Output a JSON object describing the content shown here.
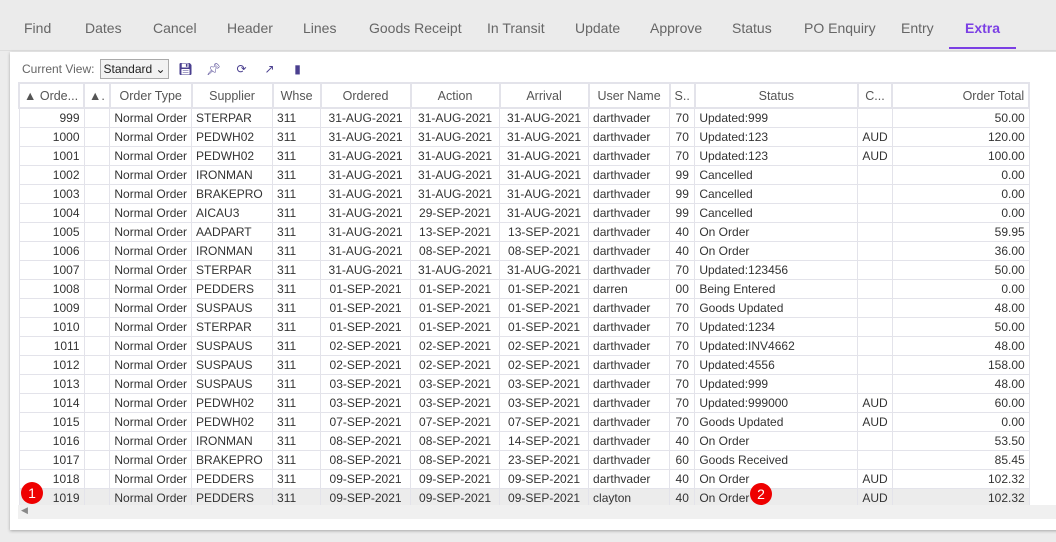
{
  "tabs": [
    "Find",
    "Dates",
    "Cancel",
    "Header",
    "Lines",
    "Goods Receipt",
    "In Transit",
    "Update",
    "Approve",
    "Status",
    "PO Enquiry",
    "Entry",
    "Extra"
  ],
  "active_tab": "Extra",
  "toolbar": {
    "view_label": "Current View:",
    "view_value": "Standard"
  },
  "columns": [
    "▲ Orde...",
    "▲.",
    "Order Type",
    "Supplier",
    "Whse",
    "Ordered",
    "Action",
    "Arrival",
    "User Name",
    "S..",
    "Status",
    "C...",
    "Order Total"
  ],
  "rows": [
    [
      "999",
      "",
      "Normal Order",
      "STERPAR",
      "311",
      "31-AUG-2021",
      "31-AUG-2021",
      "31-AUG-2021",
      "darthvader",
      "70",
      "Updated:999",
      "",
      "50.00"
    ],
    [
      "1000",
      "",
      "Normal Order",
      "PEDWH02",
      "311",
      "31-AUG-2021",
      "31-AUG-2021",
      "31-AUG-2021",
      "darthvader",
      "70",
      "Updated:123",
      "AUD",
      "120.00"
    ],
    [
      "1001",
      "",
      "Normal Order",
      "PEDWH02",
      "311",
      "31-AUG-2021",
      "31-AUG-2021",
      "31-AUG-2021",
      "darthvader",
      "70",
      "Updated:123",
      "AUD",
      "100.00"
    ],
    [
      "1002",
      "",
      "Normal Order",
      "IRONMAN",
      "311",
      "31-AUG-2021",
      "31-AUG-2021",
      "31-AUG-2021",
      "darthvader",
      "99",
      "Cancelled",
      "",
      "0.00"
    ],
    [
      "1003",
      "",
      "Normal Order",
      "BRAKEPRO",
      "311",
      "31-AUG-2021",
      "31-AUG-2021",
      "31-AUG-2021",
      "darthvader",
      "99",
      "Cancelled",
      "",
      "0.00"
    ],
    [
      "1004",
      "",
      "Normal Order",
      "AICAU3",
      "311",
      "31-AUG-2021",
      "29-SEP-2021",
      "31-AUG-2021",
      "darthvader",
      "99",
      "Cancelled",
      "",
      "0.00"
    ],
    [
      "1005",
      "",
      "Normal Order",
      "AADPART",
      "311",
      "31-AUG-2021",
      "13-SEP-2021",
      "13-SEP-2021",
      "darthvader",
      "40",
      "On Order",
      "",
      "59.95"
    ],
    [
      "1006",
      "",
      "Normal Order",
      "IRONMAN",
      "311",
      "31-AUG-2021",
      "08-SEP-2021",
      "08-SEP-2021",
      "darthvader",
      "40",
      "On Order",
      "",
      "36.00"
    ],
    [
      "1007",
      "",
      "Normal Order",
      "STERPAR",
      "311",
      "31-AUG-2021",
      "31-AUG-2021",
      "31-AUG-2021",
      "darthvader",
      "70",
      "Updated:123456",
      "",
      "50.00"
    ],
    [
      "1008",
      "",
      "Normal Order",
      "PEDDERS",
      "311",
      "01-SEP-2021",
      "01-SEP-2021",
      "01-SEP-2021",
      "darren",
      "00",
      "Being Entered",
      "",
      "0.00"
    ],
    [
      "1009",
      "",
      "Normal Order",
      "SUSPAUS",
      "311",
      "01-SEP-2021",
      "01-SEP-2021",
      "01-SEP-2021",
      "darthvader",
      "70",
      "Goods Updated",
      "",
      "48.00"
    ],
    [
      "1010",
      "",
      "Normal Order",
      "STERPAR",
      "311",
      "01-SEP-2021",
      "01-SEP-2021",
      "01-SEP-2021",
      "darthvader",
      "70",
      "Updated:1234",
      "",
      "50.00"
    ],
    [
      "1011",
      "",
      "Normal Order",
      "SUSPAUS",
      "311",
      "02-SEP-2021",
      "02-SEP-2021",
      "02-SEP-2021",
      "darthvader",
      "70",
      "Updated:INV4662",
      "",
      "48.00"
    ],
    [
      "1012",
      "",
      "Normal Order",
      "SUSPAUS",
      "311",
      "02-SEP-2021",
      "02-SEP-2021",
      "02-SEP-2021",
      "darthvader",
      "70",
      "Updated:4556",
      "",
      "158.00"
    ],
    [
      "1013",
      "",
      "Normal Order",
      "SUSPAUS",
      "311",
      "03-SEP-2021",
      "03-SEP-2021",
      "03-SEP-2021",
      "darthvader",
      "70",
      "Updated:999",
      "",
      "48.00"
    ],
    [
      "1014",
      "",
      "Normal Order",
      "PEDWH02",
      "311",
      "03-SEP-2021",
      "03-SEP-2021",
      "03-SEP-2021",
      "darthvader",
      "70",
      "Updated:999000",
      "AUD",
      "60.00"
    ],
    [
      "1015",
      "",
      "Normal Order",
      "PEDWH02",
      "311",
      "07-SEP-2021",
      "07-SEP-2021",
      "07-SEP-2021",
      "darthvader",
      "70",
      "Goods Updated",
      "AUD",
      "0.00"
    ],
    [
      "1016",
      "",
      "Normal Order",
      "IRONMAN",
      "311",
      "08-SEP-2021",
      "08-SEP-2021",
      "14-SEP-2021",
      "darthvader",
      "40",
      "On Order",
      "",
      "53.50"
    ],
    [
      "1017",
      "",
      "Normal Order",
      "BRAKEPRO",
      "311",
      "08-SEP-2021",
      "08-SEP-2021",
      "23-SEP-2021",
      "darthvader",
      "60",
      "Goods Received",
      "",
      "85.45"
    ],
    [
      "1018",
      "",
      "Normal Order",
      "PEDDERS",
      "311",
      "09-SEP-2021",
      "09-SEP-2021",
      "09-SEP-2021",
      "darthvader",
      "40",
      "On Order",
      "AUD",
      "102.32"
    ],
    [
      "1019",
      "",
      "Normal Order",
      "PEDDERS",
      "311",
      "09-SEP-2021",
      "09-SEP-2021",
      "09-SEP-2021",
      "clayton",
      "40",
      "On Order",
      "AUD",
      "102.32"
    ]
  ],
  "selected_row": "1019",
  "badges": [
    "1",
    "2"
  ],
  "colors": {
    "accent": "#7b3fe4",
    "badge": "#e00000"
  }
}
